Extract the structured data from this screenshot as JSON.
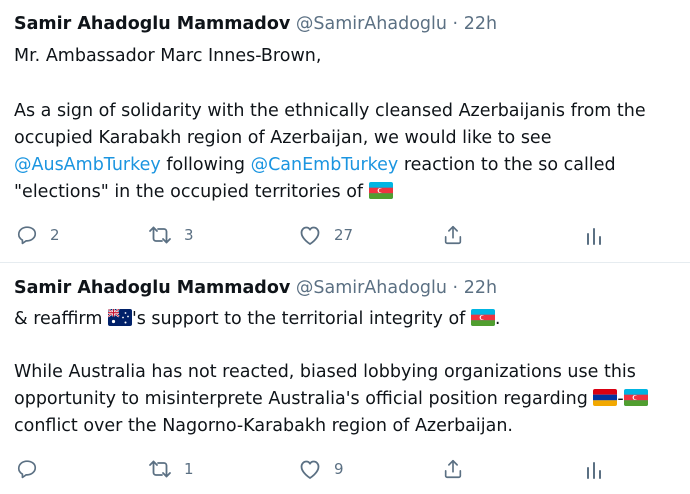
{
  "tweets": [
    {
      "author_name": "Samir Ahadoglu Mammadov",
      "handle": "@SamirAhadoglu",
      "separator": "·",
      "time": "22h",
      "lines": {
        "l1": "Mr. Ambassador Marc Innes-Brown,",
        "l2": "As a sign of solidarity with the ethnically cleansed Azerbaijanis from the",
        "l3": "occupied Karabakh region of Azerbaijan, we would like to see",
        "l4_mention1": "@AusAmbTurkey",
        "l4_mid": " following ",
        "l4_mention2": "@CanEmbTurkey",
        "l4_end": " reaction to the so called",
        "l5": "\"elections\" in the occupied territories of "
      },
      "actions": {
        "replies": "2",
        "retweets": "3",
        "likes": "27"
      }
    },
    {
      "author_name": "Samir Ahadoglu Mammadov",
      "handle": "@SamirAhadoglu",
      "separator": "·",
      "time": "22h",
      "lines": {
        "l1_start": "& reaffirm ",
        "l1_mid": "'s support to the territorial integrity of ",
        "l1_end": ".",
        "l2": "While Australia has not reacted, biased lobbying organizations use this",
        "l3": "opportunity to misinterprete Australia's official position regarding ",
        "l3_dash": "-",
        "l4": " conflict over the Nagorno-Karabakh region of Azerbaijan."
      },
      "actions": {
        "replies": "",
        "retweets": "1",
        "likes": "9"
      }
    }
  ],
  "icons": {
    "reply": "reply-icon",
    "retweet": "retweet-icon",
    "like": "heart-icon",
    "share": "share-icon",
    "analytics": "analytics-icon",
    "flag_azerbaijan": "azerbaijan-flag-icon",
    "flag_australia": "australia-flag-icon",
    "flag_armenia": "armenia-flag-icon"
  },
  "colors": {
    "text": "#0f1419",
    "secondary": "#5b7083",
    "link": "#1b95e0",
    "divider": "#e6ecf0"
  }
}
